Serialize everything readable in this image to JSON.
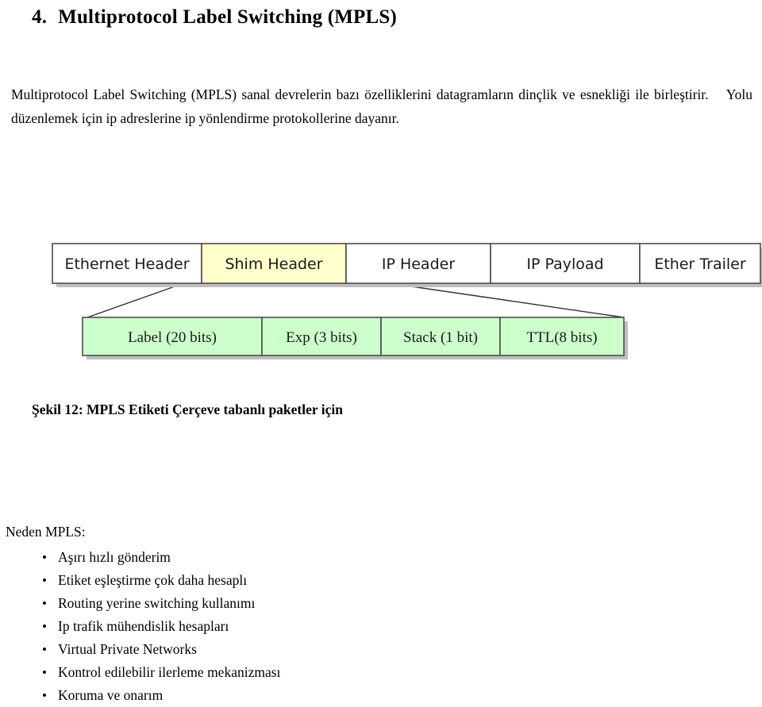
{
  "heading": {
    "number": "4.",
    "title": "Multiprotocol Label Switching (MPLS)"
  },
  "intro": {
    "line1": "Multiprotocol Label Switching (MPLS) sanal devrelerin bazı özelliklerini datagramların dinçlik ve",
    "line2": "esnekliği ile birleştirir.",
    "line2b": "Yolu düzenlemek için ip adreslerine ip yönlendirme protokollerine dayanır."
  },
  "diagram": {
    "top_row": [
      {
        "label": "Ethernet Header",
        "fill": "#ffffff"
      },
      {
        "label": "Shim Header",
        "fill": "#ffffcc"
      },
      {
        "label": "IP Header",
        "fill": "#ffffff"
      },
      {
        "label": "IP Payload",
        "fill": "#ffffff"
      },
      {
        "label": "Ether Trailer",
        "fill": "#ffffff"
      }
    ],
    "bottom_row": [
      {
        "label": "Label (20 bits)",
        "fill": "#ccffcc"
      },
      {
        "label": "Exp (3 bits)",
        "fill": "#ccffcc"
      },
      {
        "label": "Stack (1 bit)",
        "fill": "#ccffcc"
      },
      {
        "label": "TTL(8 bits)",
        "fill": "#ccffcc"
      }
    ],
    "shadow_color": "#bfbfbf",
    "border_color": "#4d4d4d"
  },
  "figure_caption": "Şekil 12: MPLS Etiketi Çerçeve tabanlı paketler için",
  "why": {
    "title": "Neden MPLS:",
    "items": [
      "Aşırı hızlı gönderim",
      "Etiket eşleştirme çok daha hesaplı",
      "Routing yerine switching kullanımı",
      "Ip trafik mühendislik hesapları",
      "Virtual Private Networks",
      "Kontrol edilebilir ilerleme mekanizması",
      "Koruma ve onarım"
    ]
  }
}
